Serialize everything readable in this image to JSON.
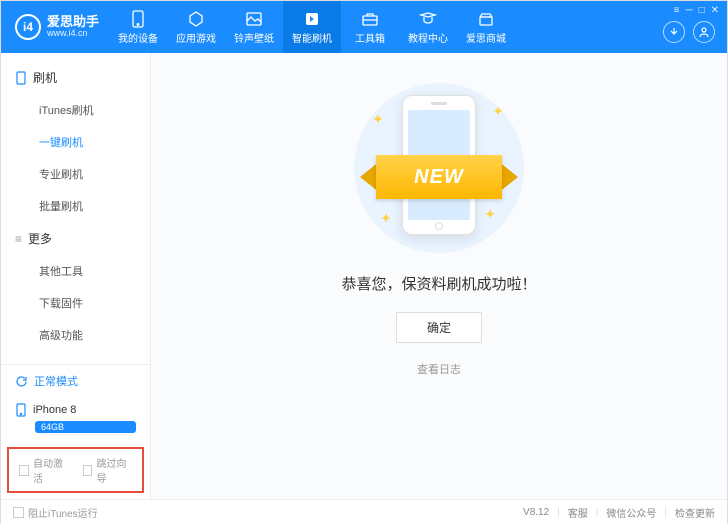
{
  "brand": {
    "title": "爱思助手",
    "url": "www.i4.cn",
    "logo": "i4"
  },
  "nav": [
    {
      "label": "我的设备",
      "icon": "device"
    },
    {
      "label": "应用游戏",
      "icon": "apps"
    },
    {
      "label": "铃声壁纸",
      "icon": "media"
    },
    {
      "label": "智能刷机",
      "icon": "flash",
      "active": true
    },
    {
      "label": "工具箱",
      "icon": "tools"
    },
    {
      "label": "教程中心",
      "icon": "tutorial"
    },
    {
      "label": "爱思商城",
      "icon": "shop"
    }
  ],
  "sidebar": {
    "group_flash": "刷机",
    "items_flash": [
      "iTunes刷机",
      "一键刷机",
      "专业刷机",
      "批量刷机"
    ],
    "active_flash": 1,
    "group_more": "更多",
    "items_more": [
      "其他工具",
      "下载固件",
      "高级功能"
    ]
  },
  "status": {
    "mode": "正常模式",
    "device": "iPhone 8",
    "storage": "64GB"
  },
  "options": {
    "auto_activate": "自动激活",
    "skip_guide": "跳过向导"
  },
  "main": {
    "ribbon": "NEW",
    "message": "恭喜您，保资料刷机成功啦！",
    "ok": "确定",
    "log": "查看日志"
  },
  "footer": {
    "block_itunes": "阻止iTunes运行",
    "version": "V8.12",
    "support": "客服",
    "wechat": "微信公众号",
    "update": "检查更新"
  }
}
